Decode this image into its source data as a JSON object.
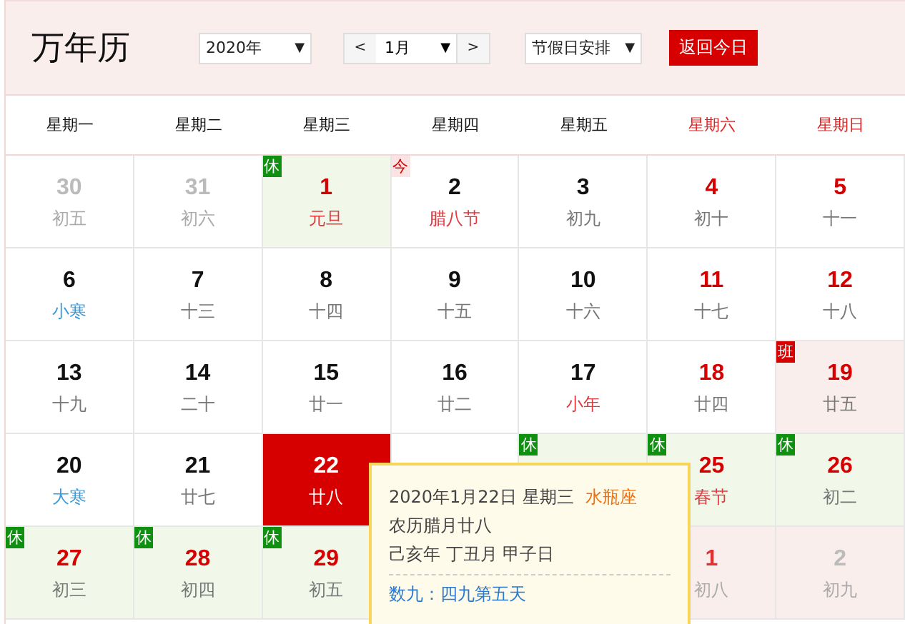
{
  "title": "万年历",
  "controls": {
    "year": "2020年",
    "prev": "<",
    "month": "1月",
    "next": ">",
    "mode": "节假日安排",
    "today_button": "返回今日",
    "caret": "▼"
  },
  "weekdays": [
    {
      "label": "星期一",
      "weekend": false
    },
    {
      "label": "星期二",
      "weekend": false
    },
    {
      "label": "星期三",
      "weekend": false
    },
    {
      "label": "星期四",
      "weekend": false
    },
    {
      "label": "星期五",
      "weekend": false
    },
    {
      "label": "星期六",
      "weekend": true
    },
    {
      "label": "星期日",
      "weekend": true
    }
  ],
  "weeks": [
    [
      {
        "day": "30",
        "lunar": "初五",
        "festival": false,
        "solar_term": false,
        "other_month": true,
        "weekend": false,
        "selected": false
      },
      {
        "day": "31",
        "lunar": "初六",
        "festival": false,
        "solar_term": false,
        "other_month": true,
        "weekend": false,
        "selected": false
      },
      {
        "day": "1",
        "lunar": "元旦",
        "festival": true,
        "solar_term": false,
        "other_month": false,
        "weekend": true,
        "color": "#f1f8ea",
        "badge": {
          "text": "休",
          "color": "#109010"
        },
        "selected": false
      },
      {
        "day": "2",
        "lunar": "腊八节",
        "festival": true,
        "solar_term": false,
        "other_month": false,
        "weekend": false,
        "badge": {
          "text": "今",
          "color": "#fbe3e3"
        },
        "selected": false
      },
      {
        "day": "3",
        "lunar": "初九",
        "festival": false,
        "solar_term": false,
        "other_month": false,
        "weekend": false,
        "selected": false
      },
      {
        "day": "4",
        "lunar": "初十",
        "festival": false,
        "solar_term": false,
        "other_month": false,
        "weekend": true,
        "selected": false
      },
      {
        "day": "5",
        "lunar": "十一",
        "festival": false,
        "solar_term": false,
        "other_month": false,
        "weekend": true,
        "selected": false
      }
    ],
    [
      {
        "day": "6",
        "lunar": "小寒",
        "festival": false,
        "solar_term": true,
        "other_month": false,
        "weekend": false,
        "selected": false
      },
      {
        "day": "7",
        "lunar": "十三",
        "festival": false,
        "solar_term": false,
        "other_month": false,
        "weekend": false,
        "selected": false
      },
      {
        "day": "8",
        "lunar": "十四",
        "festival": false,
        "solar_term": false,
        "other_month": false,
        "weekend": false,
        "selected": false
      },
      {
        "day": "9",
        "lunar": "十五",
        "festival": false,
        "solar_term": false,
        "other_month": false,
        "weekend": false,
        "selected": false
      },
      {
        "day": "10",
        "lunar": "十六",
        "festival": false,
        "solar_term": false,
        "other_month": false,
        "weekend": false,
        "selected": false
      },
      {
        "day": "11",
        "lunar": "十七",
        "festival": false,
        "solar_term": false,
        "other_month": false,
        "weekend": true,
        "selected": false
      },
      {
        "day": "12",
        "lunar": "十八",
        "festival": false,
        "solar_term": false,
        "other_month": false,
        "weekend": true,
        "selected": false
      }
    ],
    [
      {
        "day": "13",
        "lunar": "十九",
        "festival": false,
        "solar_term": false,
        "other_month": false,
        "weekend": false,
        "selected": false
      },
      {
        "day": "14",
        "lunar": "二十",
        "festival": false,
        "solar_term": false,
        "other_month": false,
        "weekend": false,
        "selected": false
      },
      {
        "day": "15",
        "lunar": "廿一",
        "festival": false,
        "solar_term": false,
        "other_month": false,
        "weekend": false,
        "selected": false
      },
      {
        "day": "16",
        "lunar": "廿二",
        "festival": false,
        "solar_term": false,
        "other_month": false,
        "weekend": false,
        "selected": false
      },
      {
        "day": "17",
        "lunar": "小年",
        "festival": true,
        "solar_term": false,
        "other_month": false,
        "weekend": false,
        "selected": false
      },
      {
        "day": "18",
        "lunar": "廿四",
        "festival": false,
        "solar_term": false,
        "other_month": false,
        "weekend": true,
        "selected": false
      },
      {
        "day": "19",
        "lunar": "廿五",
        "festival": false,
        "solar_term": false,
        "other_month": false,
        "weekend": true,
        "color": "#faeeec",
        "badge": {
          "text": "班",
          "color": "#d60000"
        },
        "selected": false
      }
    ],
    [
      {
        "day": "20",
        "lunar": "大寒",
        "festival": false,
        "solar_term": true,
        "other_month": false,
        "weekend": false,
        "selected": false
      },
      {
        "day": "21",
        "lunar": "廿七",
        "festival": false,
        "solar_term": false,
        "other_month": false,
        "weekend": false,
        "selected": false
      },
      {
        "day": "22",
        "lunar": "廿八",
        "festival": false,
        "solar_term": false,
        "other_month": false,
        "weekend": false,
        "selected": true
      },
      {
        "selected": false
      },
      {
        "color": "#f1f8ea",
        "badge": {
          "text": "休",
          "color": "#109010"
        }
      },
      {
        "day": "25",
        "lunar": "春节",
        "festival": true,
        "solar_term": false,
        "other_month": false,
        "weekend": true,
        "color": "#f1f8ea",
        "badge": {
          "text": "休",
          "color": "#109010"
        },
        "selected": false
      },
      {
        "day": "26",
        "lunar": "初二",
        "festival": false,
        "solar_term": false,
        "other_month": false,
        "weekend": true,
        "color": "#f1f8ea",
        "badge": {
          "text": "休",
          "color": "#109010"
        },
        "selected": false
      }
    ],
    {
      "leading": [
        {
          "day": "27",
          "lunar": "初三",
          "festival": false,
          "solar_term": false,
          "other_month": false,
          "weekend": true,
          "color": "#f1f8ea",
          "badge": {
            "text": "休",
            "color": "#109010"
          },
          "selected": false
        },
        {
          "day": "28",
          "lunar": "初四",
          "festival": false,
          "solar_term": false,
          "other_month": false,
          "weekend": true,
          "color": "#f1f8ea",
          "badge": {
            "text": "休",
            "color": "#109010"
          },
          "selected": false
        },
        {
          "day": "29",
          "lunar": "初五",
          "festival": false,
          "solar_term": false,
          "other_month": false,
          "weekend": true,
          "color": "#f1f8ea",
          "badge": {
            "text": "休",
            "color": "#109010"
          },
          "selected": false
        }
      ],
      "trailing": [
        {
          "day": "1",
          "lunar": "初八",
          "festival": false,
          "solar_term": false,
          "other_month": true,
          "weekend": true,
          "color": "#faeeec",
          "selected": false
        },
        {
          "day": "2",
          "lunar": "初九",
          "festival": false,
          "solar_term": false,
          "other_month": true,
          "weekend": false,
          "color": "#faeeec",
          "selected": false
        }
      ]
    }
  ],
  "popup": {
    "date": "2020年1月22日 星期三",
    "zodiac": "水瓶座",
    "lunar_date": "农历腊月廿八",
    "ganzhi": "己亥年 丁丑月 甲子日",
    "shujiu": "数九：四九第五天"
  }
}
